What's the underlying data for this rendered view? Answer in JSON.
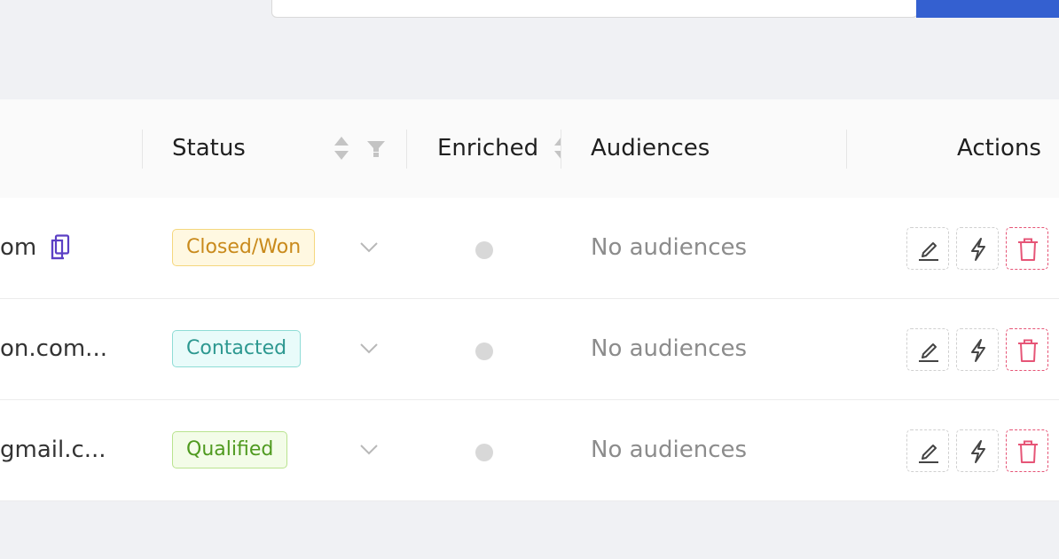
{
  "header": {
    "columns": {
      "status": "Status",
      "enriched": "Enriched",
      "audiences": "Audiences",
      "actions": "Actions"
    }
  },
  "rows": [
    {
      "email": "om",
      "status": "Closed/Won",
      "status_colors": {
        "bg": "#fff8e1",
        "border": "#f5d77e",
        "text": "#c98a1c"
      },
      "audiences": "No audiences",
      "has_copy_icon": true
    },
    {
      "email": "on.com...",
      "status": "Contacted",
      "status_colors": {
        "bg": "#e9fbfa",
        "border": "#8fdcd6",
        "text": "#2d9890"
      },
      "audiences": "No audiences",
      "has_copy_icon": false
    },
    {
      "email": "gmail.c...",
      "status": "Qualified",
      "status_colors": {
        "bg": "#f3fce8",
        "border": "#b9e38f",
        "text": "#4f9a1f"
      },
      "audiences": "No audiences",
      "has_copy_icon": false
    }
  ],
  "icons": {
    "copy": "copy-icon",
    "edit": "edit-icon",
    "enrich": "lightning-icon",
    "delete": "trash-icon",
    "status_dropdown": "chevron-down-icon",
    "sort": "sort-icon",
    "filter": "filter-icon"
  },
  "colors": {
    "accent": "#3460d0",
    "danger": "#e65577",
    "copy_icon": "#5b3fc4"
  }
}
